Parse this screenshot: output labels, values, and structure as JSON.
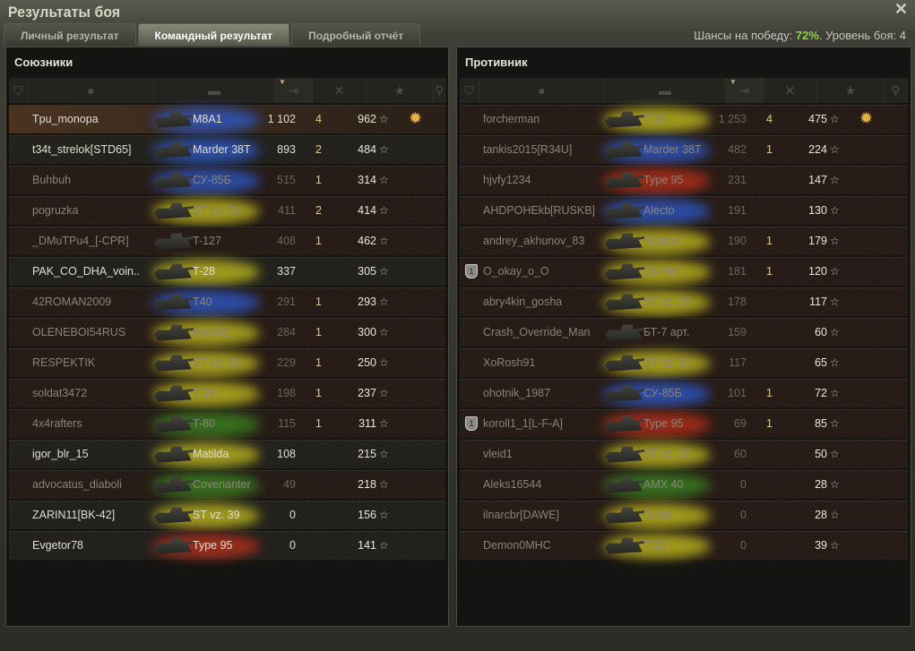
{
  "window": {
    "title": "Результаты боя",
    "close": "✕"
  },
  "tabs": [
    {
      "label": "Личный результат"
    },
    {
      "label": "Командный результат",
      "active": true
    },
    {
      "label": "Подробный отчёт"
    }
  ],
  "chances": {
    "label": "Шансы на победу:",
    "value": "72%",
    "level_label": ". Уровень боя: 4"
  },
  "colors": {
    "blue": "#2d5bd0",
    "yellow": "#c8c21e",
    "red": "#c0301a",
    "green": "#3a8a20",
    "win": "#8fd13f"
  },
  "columns": [
    "squad-icon",
    "player-icon",
    "tank-icon",
    "damage-icon",
    "frags-icon",
    "experience-icon",
    "medal-icon"
  ],
  "allies": {
    "title": "Союзники",
    "rows": [
      {
        "name": "Tpu_monopa",
        "tank": "M8A1",
        "dmg": "1 102",
        "frags": "4",
        "xp": "962",
        "cls": "blue",
        "alive": true,
        "player": true,
        "medal": true
      },
      {
        "name": "t34t_strelok[STD65]",
        "tank": "Marder 38T",
        "dmg": "893",
        "frags": "2",
        "xp": "484",
        "cls": "blue",
        "alive": true
      },
      {
        "name": "Buhbuh",
        "tank": "СУ-85Б",
        "dmg": "515",
        "frags": "1",
        "xp": "314",
        "cls": "blue"
      },
      {
        "name": "pogruzka",
        "tank": "ST vz. 39",
        "dmg": "411",
        "frags": "2",
        "xp": "414",
        "cls": "yellow"
      },
      {
        "name": "_DMuTPu4_[-CPR]",
        "tank": "T-127",
        "dmg": "408",
        "frags": "1",
        "xp": "462",
        "cls": "none"
      },
      {
        "name": "PAK_CO_DHA_voin..",
        "tank": "T-28",
        "dmg": "337",
        "frags": "",
        "xp": "305",
        "cls": "yellow",
        "alive": true
      },
      {
        "name": "42ROMAN2009",
        "tank": "T40",
        "dmg": "291",
        "frags": "1",
        "xp": "293",
        "cls": "blue"
      },
      {
        "name": "OLENEBOI54RUS",
        "tank": "Matilda",
        "dmg": "284",
        "frags": "1",
        "xp": "300",
        "cls": "yellow"
      },
      {
        "name": "RESPEKTIK",
        "tank": "ST vz. 39",
        "dmg": "229",
        "frags": "1",
        "xp": "250",
        "cls": "yellow"
      },
      {
        "name": "soldat3472",
        "tank": "T-28",
        "dmg": "198",
        "frags": "1",
        "xp": "237",
        "cls": "yellow"
      },
      {
        "name": "4x4rafters",
        "tank": "T-80",
        "dmg": "115",
        "frags": "1",
        "xp": "311",
        "cls": "green"
      },
      {
        "name": "igor_blr_15",
        "tank": "Matilda",
        "dmg": "108",
        "frags": "",
        "xp": "215",
        "cls": "yellow",
        "alive": true
      },
      {
        "name": "advocatus_diaboli",
        "tank": "Covenanter",
        "dmg": "49",
        "frags": "",
        "xp": "218",
        "cls": "green"
      },
      {
        "name": "ZARIN11[BK-42]",
        "tank": "ST vz. 39",
        "dmg": "0",
        "frags": "",
        "xp": "156",
        "cls": "yellow",
        "alive": true
      },
      {
        "name": "Evgetor78",
        "tank": "Type 95",
        "dmg": "0",
        "frags": "",
        "xp": "141",
        "cls": "red",
        "alive": true
      }
    ]
  },
  "enemies": {
    "title": "Противник",
    "rows": [
      {
        "name": "forcherman",
        "tank": "T-28",
        "dmg": "1 253",
        "frags": "4",
        "xp": "475",
        "cls": "yellow",
        "medal": true
      },
      {
        "name": "tankis2015[R34U]",
        "tank": "Marder 38T",
        "dmg": "482",
        "frags": "1",
        "xp": "224",
        "cls": "blue"
      },
      {
        "name": "hjvfy1234",
        "tank": "Type 95",
        "dmg": "231",
        "frags": "",
        "xp": "147",
        "cls": "red"
      },
      {
        "name": "AHDPOHEkb[RUSKB]",
        "tank": "Alecto",
        "dmg": "191",
        "frags": "",
        "xp": "130",
        "cls": "blue"
      },
      {
        "name": "andrey_akhunov_83",
        "tank": "Matilda",
        "dmg": "190",
        "frags": "1",
        "xp": "179",
        "cls": "yellow"
      },
      {
        "name": "O_okay_o_O",
        "tank": "Chi-He",
        "dmg": "181",
        "frags": "1",
        "xp": "120",
        "cls": "yellow",
        "squad": "1"
      },
      {
        "name": "abry4kin_gosha",
        "tank": "ST vz. 39",
        "dmg": "178",
        "frags": "",
        "xp": "117",
        "cls": "yellow"
      },
      {
        "name": "Crash_Override_Man",
        "tank": "БТ-7 арт.",
        "dmg": "159",
        "frags": "",
        "xp": "60",
        "cls": "none"
      },
      {
        "name": "XoRosh91",
        "tank": "ST vz. 39",
        "dmg": "117",
        "frags": "",
        "xp": "65",
        "cls": "yellow"
      },
      {
        "name": "ohotnik_1987",
        "tank": "СУ-85Б",
        "dmg": "101",
        "frags": "1",
        "xp": "72",
        "cls": "blue"
      },
      {
        "name": "koroll1_1[L-F-A]",
        "tank": "Type 95",
        "dmg": "69",
        "frags": "1",
        "xp": "85",
        "cls": "red",
        "squad": "1"
      },
      {
        "name": "vleid1",
        "tank": "ST vz. 39",
        "dmg": "60",
        "frags": "",
        "xp": "50",
        "cls": "yellow"
      },
      {
        "name": "Aleks16544",
        "tank": "AMX 40",
        "dmg": "0",
        "frags": "",
        "xp": "28",
        "cls": "green"
      },
      {
        "name": "ilnarcbr[DAWE]",
        "tank": "Grant",
        "dmg": "0",
        "frags": "",
        "xp": "28",
        "cls": "yellow"
      },
      {
        "name": "Demon0MHC",
        "tank": "T-28",
        "dmg": "0",
        "frags": "",
        "xp": "39",
        "cls": "yellow"
      }
    ]
  }
}
